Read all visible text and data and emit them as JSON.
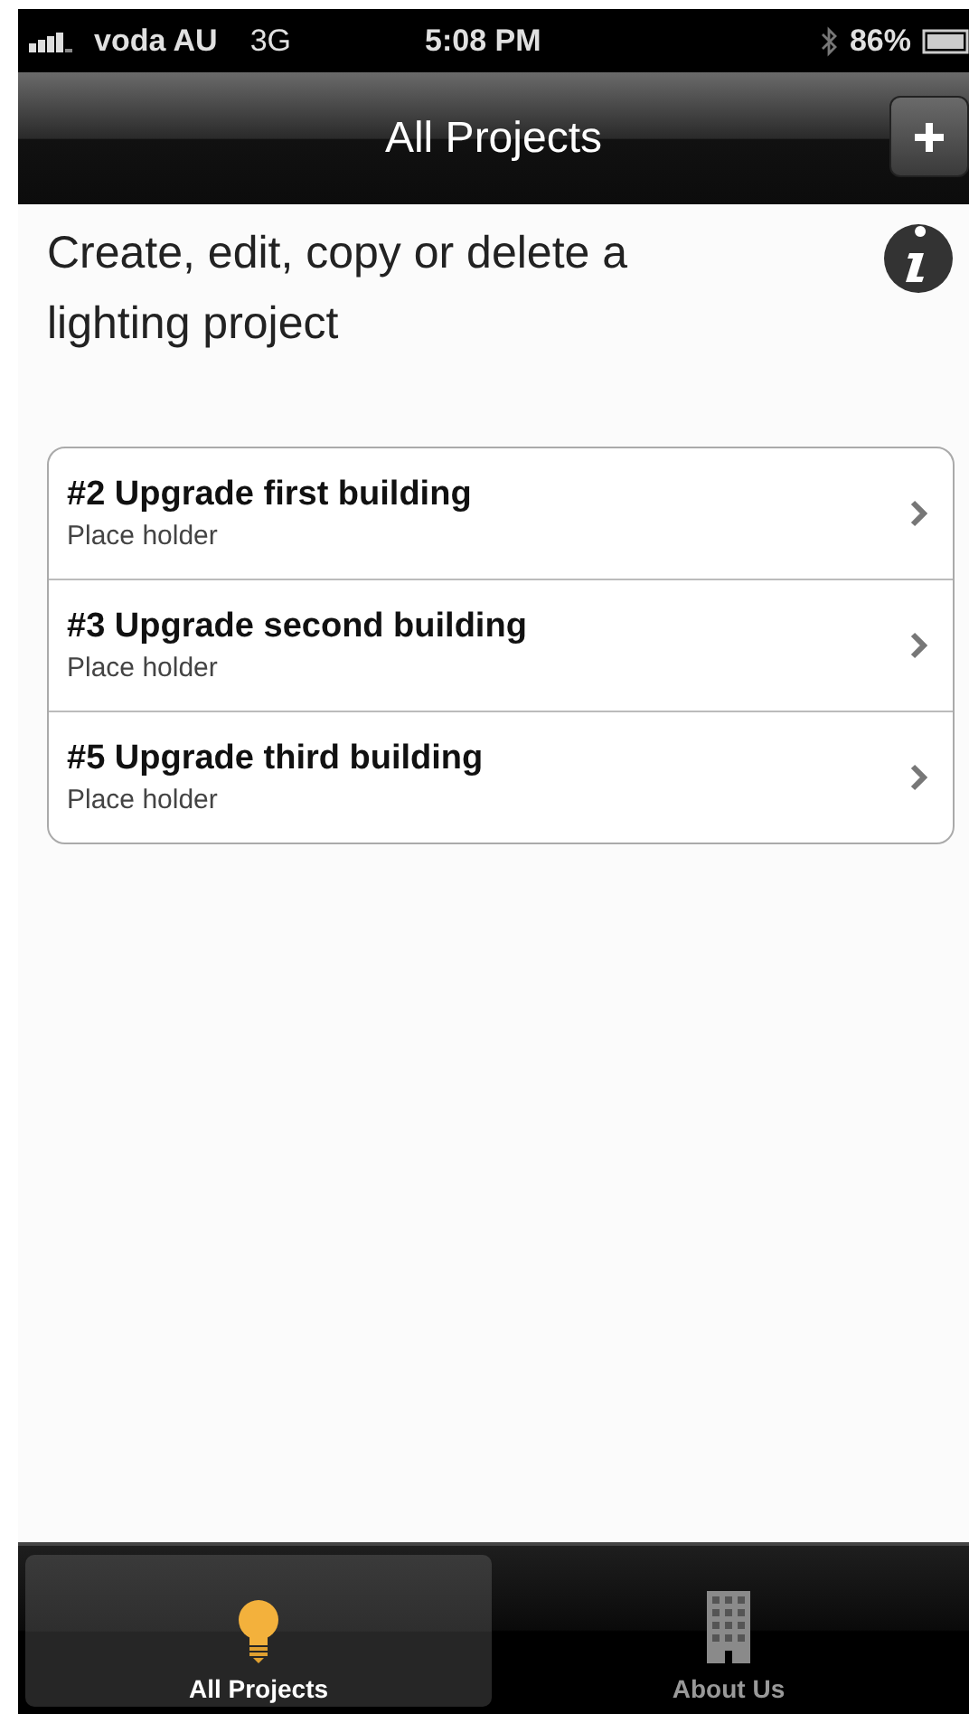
{
  "status_bar": {
    "carrier": "voda AU",
    "network": "3G",
    "time": "5:08 PM",
    "battery": "86%"
  },
  "nav_bar": {
    "title": "All Projects"
  },
  "intro": "Create, edit, copy or delete a lighting project",
  "projects": [
    {
      "title": "#2 Upgrade first building",
      "subtitle": "Place holder"
    },
    {
      "title": "#3 Upgrade second building",
      "subtitle": "Place holder"
    },
    {
      "title": "#5 Upgrade third building",
      "subtitle": "Place holder"
    }
  ],
  "tabs": [
    {
      "label": "All Projects",
      "kind": "bulb",
      "selected": true
    },
    {
      "label": "About Us",
      "kind": "building",
      "selected": false
    }
  ]
}
